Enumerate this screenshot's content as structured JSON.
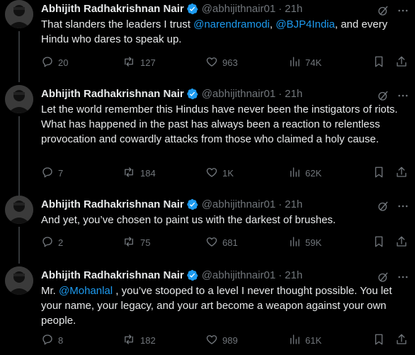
{
  "tweets": [
    {
      "author": "Abhijith Radhakrishnan Nair",
      "handle": "@abhijithnair01",
      "separator": "·",
      "time": "21h",
      "text_before": "That slanders the leaders I trust ",
      "mention1": "@narendramodi",
      "text_mid": ", ",
      "mention2": "@BJP4India",
      "text_after": ", and every Hindu who dares to speak up.",
      "replies": "20",
      "reposts": "127",
      "likes": "963",
      "views": "74K"
    },
    {
      "author": "Abhijith Radhakrishnan Nair",
      "handle": "@abhijithnair01",
      "separator": "·",
      "time": "21h",
      "text": "Let the world remember this Hindus have never been the instigators of riots. What has happened in the past has always been a reaction to relentless provocation and cowardly attacks from those who claimed a holy cause.",
      "replies": "7",
      "reposts": "184",
      "likes": "1K",
      "views": "62K"
    },
    {
      "author": "Abhijith Radhakrishnan Nair",
      "handle": "@abhijithnair01",
      "separator": "·",
      "time": "21h",
      "text": "And yet, you’ve chosen to paint us with the darkest of brushes.",
      "replies": "2",
      "reposts": "75",
      "likes": "681",
      "views": "59K"
    },
    {
      "author": "Abhijith Radhakrishnan Nair",
      "handle": "@abhijithnair01",
      "separator": "·",
      "time": "21h",
      "text_before": "Mr. ",
      "mention1": "@Mohanlal",
      "text_after": " , you’ve stooped to a level I never thought possible. You let your name, your legacy, and your art become a weapon against your own people.",
      "replies": "8",
      "reposts": "182",
      "likes": "989",
      "views": "61K"
    }
  ],
  "icons": {
    "verified": "verified-badge-icon",
    "grok": "grok-icon",
    "more": "more-icon",
    "reply": "reply-icon",
    "repost": "repost-icon",
    "like": "like-icon",
    "views": "views-icon",
    "bookmark": "bookmark-icon",
    "share": "share-icon"
  },
  "colors": {
    "background": "#000000",
    "text": "#e7e9ea",
    "muted": "#71767b",
    "link": "#1d9bf0",
    "verified": "#1d9bf0"
  }
}
